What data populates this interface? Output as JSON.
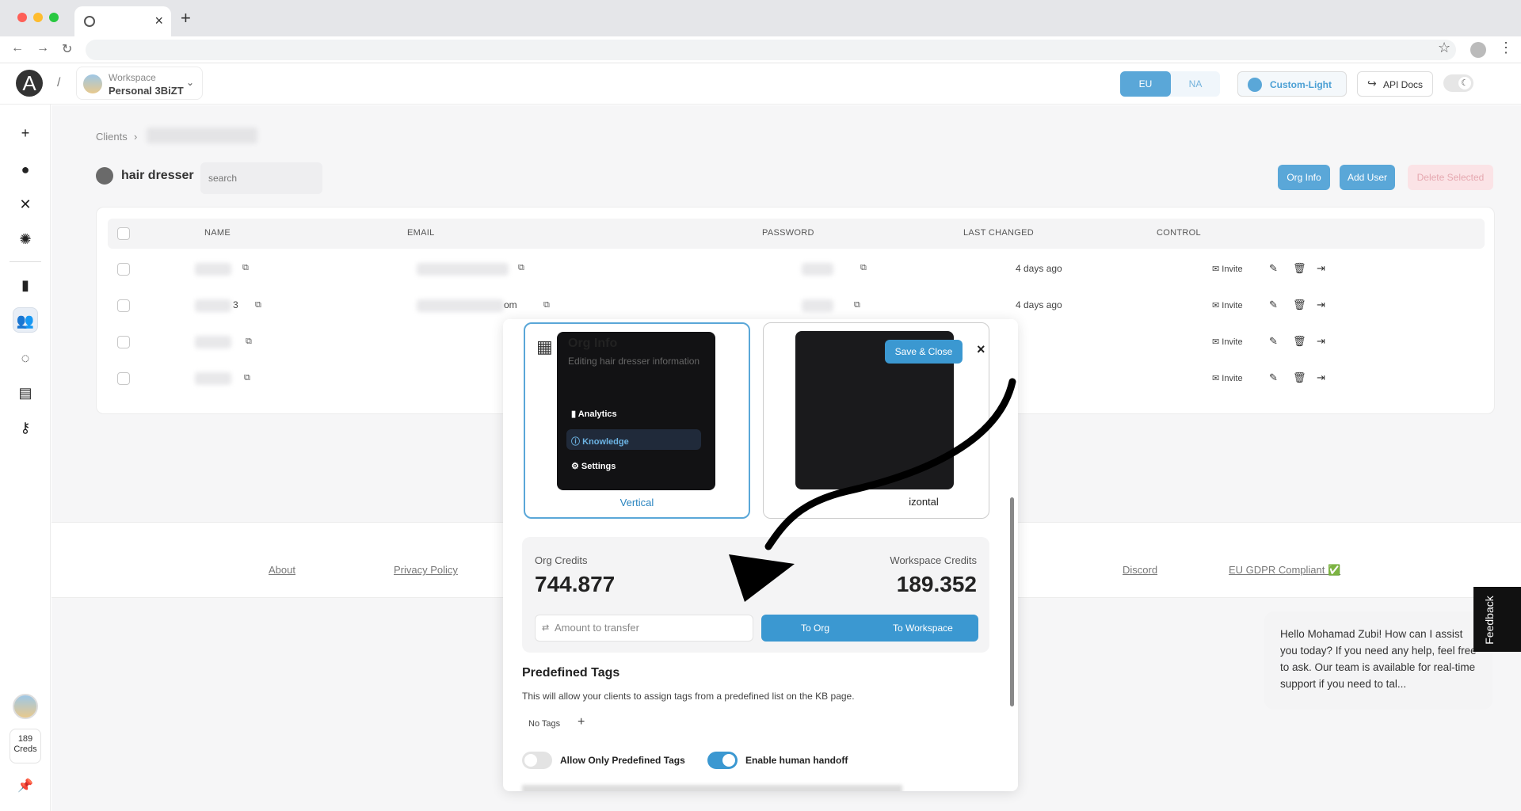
{
  "browser": {
    "tab_title": "",
    "new_tab": "+",
    "close": "×"
  },
  "header": {
    "logo": "A",
    "separator": "/",
    "workspace_label": "Workspace",
    "workspace_name": "Personal 3BiZT",
    "regions": [
      "EU",
      "NA"
    ],
    "theme": "Custom-Light",
    "api_docs": "API Docs"
  },
  "sidebar": {
    "credits_value": "189",
    "credits_label": "Creds"
  },
  "page": {
    "breadcrumb": "Clients",
    "org_title": "hair dresser",
    "search_placeholder": "search",
    "buttons": {
      "org_info": "Org Info",
      "add_user": "Add User",
      "delete_selected": "Delete Selected"
    },
    "columns": [
      "NAME",
      "EMAIL",
      "PASSWORD",
      "LAST CHANGED",
      "CONTROL"
    ],
    "rows": [
      {
        "last_changed": "4 days ago",
        "invite": "Invite"
      },
      {
        "last_changed": "4 days ago",
        "invite": "Invite",
        "name_frag": "3",
        "email_frag": "om"
      },
      {
        "last_changed": "",
        "invite": "Invite"
      },
      {
        "last_changed": "",
        "invite": "Invite"
      }
    ]
  },
  "footer": {
    "links": [
      "About",
      "Privacy Policy",
      "Discord",
      "EU GDPR Compliant ✅"
    ]
  },
  "modal": {
    "title": "Org Info",
    "subtitle": "Editing hair dresser information",
    "save_close": "Save & Close",
    "close": "×",
    "layouts": {
      "vertical": "Vertical",
      "horizontal": "izontal"
    },
    "preview_menu": [
      "Analytics",
      "Knowledge",
      "Settings"
    ],
    "credits": {
      "org_label": "Org Credits",
      "org_value": "744.877",
      "workspace_label": "Workspace Credits",
      "workspace_value": "189.352",
      "amount_placeholder": "Amount to transfer",
      "to_org": "To Org",
      "to_workspace": "To Workspace"
    },
    "tags": {
      "title": "Predefined Tags",
      "description": "This will allow your clients to assign tags from a predefined list on the KB page.",
      "no_tags": "No Tags",
      "add": "+"
    },
    "toggles": [
      {
        "label": "Allow Only Predefined Tags",
        "on": false
      },
      {
        "label": "Enable human handoff",
        "on": true
      }
    ]
  },
  "chat": {
    "message": "Hello Mohamad Zubi! How can I assist you today? If you need any help, feel free to ask. Our team is available for real-time support if you need to tal..."
  },
  "feedback": "Feedback",
  "colors": {
    "accent": "#3b98d1",
    "accent_light": "#5aa7d8",
    "danger_light": "#fbe3e6"
  }
}
